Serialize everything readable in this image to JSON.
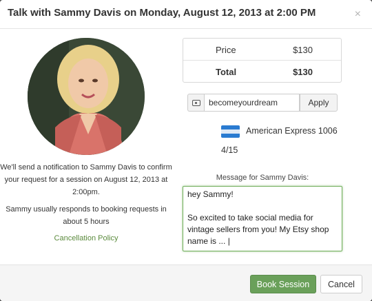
{
  "modal": {
    "title": "Talk with Sammy Davis on Monday, August 12, 2013 at 2:00 PM",
    "close_label": "×"
  },
  "left": {
    "notice": "We'll send a notification to Sammy Davis to confirm your request for a session on August 12, 2013 at 2:00pm.",
    "response": "Sammy usually responds to booking requests in about 5 hours",
    "cancellation_link": "Cancellation Policy"
  },
  "pricing": {
    "rows": [
      {
        "label": "Price",
        "value": "$130"
      },
      {
        "label": "Total",
        "value": "$130"
      }
    ]
  },
  "coupon": {
    "icon": "money-icon",
    "value": "becomeyourdream",
    "apply_label": "Apply"
  },
  "payment": {
    "card_icon": "american-express-card-icon",
    "card_label": "American Express 1006",
    "expiry": "4/15"
  },
  "message": {
    "label": "Message for Sammy Davis:",
    "value": "hey Sammy!\n\nSo excited to take social media for vintage sellers from you! My Etsy shop name is ... |"
  },
  "footer": {
    "book_label": "Book Session",
    "cancel_label": "Cancel"
  },
  "colors": {
    "accent_green": "#6aa05a",
    "link_green": "#5a8a3c",
    "card_blue": "#2a7bd1"
  }
}
